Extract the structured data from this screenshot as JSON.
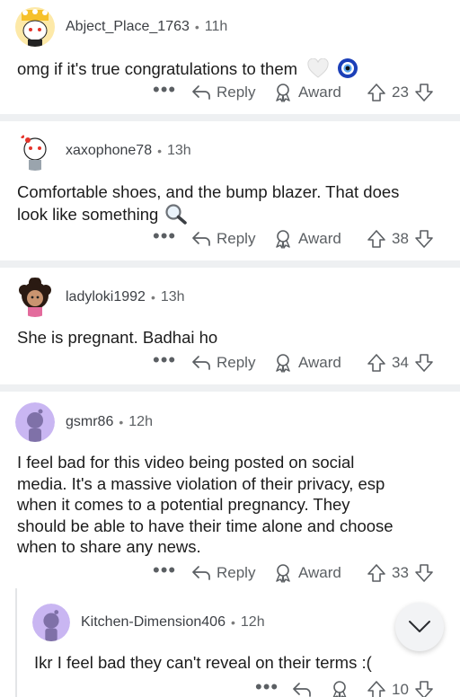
{
  "comments": [
    {
      "username": "Abject_Place_1763",
      "time": "11h",
      "text": "omg if it's true congratulations to them",
      "emojis": [
        "white-heart",
        "nazar-amulet"
      ],
      "actions": {
        "more": "•••",
        "reply": "Reply",
        "award": "Award",
        "votes": "23"
      }
    },
    {
      "username": "xaxophone78",
      "time": "13h",
      "text_lines": [
        "Comfortable shoes, and the bump blazer. That does",
        "look like something"
      ],
      "emojis": [
        "magnifying-glass"
      ],
      "actions": {
        "more": "•••",
        "reply": "Reply",
        "award": "Award",
        "votes": "38"
      }
    },
    {
      "username": "ladyloki1992",
      "time": "13h",
      "text": "She is pregnant. Badhai ho",
      "actions": {
        "more": "•••",
        "reply": "Reply",
        "award": "Award",
        "votes": "34"
      }
    },
    {
      "username": "gsmr86",
      "time": "12h",
      "text_lines": [
        "I feel bad for this video being posted on social",
        "media. It's a massive violation of their privacy, esp",
        "when it comes to a potential pregnancy. They",
        "should be able to have their time alone and choose",
        "when to share any news."
      ],
      "actions": {
        "more": "•••",
        "reply": "Reply",
        "award": "Award",
        "votes": "33"
      }
    },
    {
      "username": "Kitchen-Dimension406",
      "time": "12h",
      "text": "Ikr I feel bad they can't reveal on their terms :(",
      "actions": {
        "more": "•••",
        "votes": "10"
      }
    }
  ],
  "scroll_button": {
    "icon": "chevron-down-icon"
  },
  "colors": {
    "separator": "#eef0f2",
    "meta": "#5b5f63",
    "text": "#1c1c1c",
    "avatar_default": "#c9b6f2"
  }
}
